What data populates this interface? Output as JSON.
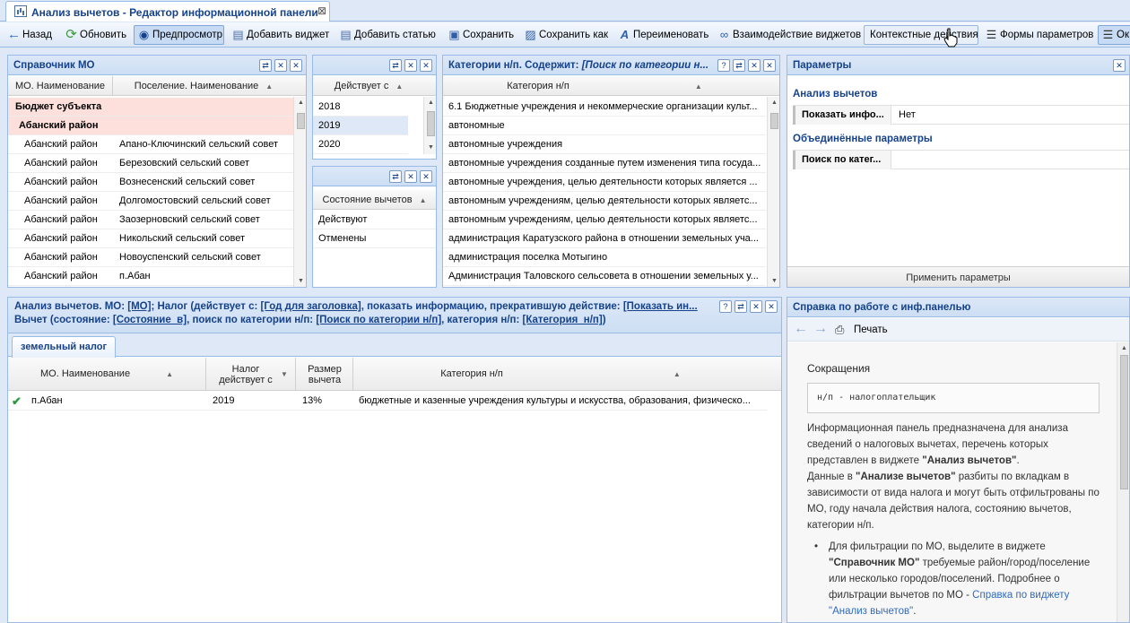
{
  "doc_tab": {
    "title": "Анализ вычетов - Редактор информационной панели",
    "close": "⊠"
  },
  "toolbar": {
    "back": "Назад",
    "refresh": "Обновить",
    "preview": "Предпросмотр",
    "add_widget": "Добавить виджет",
    "add_article": "Добавить статью",
    "save": "Сохранить",
    "save_as": "Сохранить как",
    "rename": "Переименовать",
    "widget_interaction": "Взаимодействие виджетов",
    "context_actions": "Контекстные действия",
    "param_forms": "Формы параметров",
    "ok": "Ок"
  },
  "mo_panel": {
    "title": "Справочник МО",
    "columns": [
      "МО. Наименование",
      "Поселение. Наименование"
    ],
    "rows": [
      {
        "mo": "Бюджет субъекта",
        "settlement": "",
        "style": "pink-bold"
      },
      {
        "mo": "Абанский район",
        "settlement": "",
        "style": "pink-bold-indent"
      },
      {
        "mo": "Абанский район",
        "settlement": "Апано-Ключинский сельский совет"
      },
      {
        "mo": "Абанский район",
        "settlement": "Березовский сельский совет"
      },
      {
        "mo": "Абанский район",
        "settlement": "Вознесенский сельский совет"
      },
      {
        "mo": "Абанский район",
        "settlement": "Долгомостовский сельский совет"
      },
      {
        "mo": "Абанский район",
        "settlement": "Заозерновский сельский совет"
      },
      {
        "mo": "Абанский район",
        "settlement": "Никольский сельский совет"
      },
      {
        "mo": "Абанский район",
        "settlement": "Новоуспенский сельский совет"
      },
      {
        "mo": "Абанский район",
        "settlement": "п.Абан"
      }
    ]
  },
  "year_panel": {
    "column": "Действует с",
    "rows": [
      "2018",
      "2019",
      "2020"
    ]
  },
  "state_panel": {
    "column": "Состояние вычетов",
    "rows": [
      "Действуют",
      "Отменены"
    ]
  },
  "cat_panel": {
    "title": "Категории н/п. Содержит: ",
    "title_italic": "[Поиск по категории н...",
    "column": "Категория н/п",
    "rows": [
      "6.1 Бюджетные учреждения и некоммерческие организации культ...",
      "автономные",
      "автономные учреждения",
      "автономные учреждения созданные путем изменения типа госуда...",
      "автономные учреждения, целью деятельности которых является ...",
      "автономным учреждениям, целью деятельности которых являетс...",
      "автономным учреждениям, целью деятельности которых являетс...",
      "администрация Каратузского района в отношении земельных уча...",
      "администрация поселка Мотыгино",
      "Администрация Таловского сельсовета в отношении земельных у..."
    ]
  },
  "params_panel": {
    "title": "Параметры",
    "section1": "Анализ вычетов",
    "prop1_key": "Показать инфо...",
    "prop1_val": "Нет",
    "section2": "Объединённые параметры",
    "prop2_key": "Поиск по катег...",
    "apply": "Применить параметры"
  },
  "analysis_panel": {
    "line1_a": "Анализ вычетов. МО: ",
    "link_mo": "[МО]",
    "line1_b": "; Налог (действует с: ",
    "link_year": "[Год для заголовка]",
    "line1_c": ", показать информацию, прекратившую действие: ",
    "link_show": "[Показать ин...",
    "line2_a": "Вычет (состояние: ",
    "link_state": "[Состояние_в]",
    "line2_b": ", поиск по категории н/п: ",
    "link_search": "[Поиск по категории н/п]",
    "line2_c": ", категория н/п: ",
    "link_cat": "[Категория_н/п]",
    "line2_d": ")",
    "tab": "земельный налог",
    "columns": {
      "mo": "МО. Наименование",
      "year": "Налог действует с",
      "size": "Размер вычета",
      "cat": "Категория н/п"
    },
    "rows": [
      {
        "mo": "п.Абан",
        "year": "2019",
        "size": "13%",
        "cat": "бюджетные и казенные учреждения культуры и искусства, образования, физическо..."
      }
    ]
  },
  "help_panel": {
    "title": "Справка по работе с инф.панелью",
    "print": "Печать",
    "heading": "Сокращения",
    "abbrev": "н/п -   налогоплательщик",
    "p1_a": "Информационная панель предназначена для анализа сведений о налоговых вычетах, перечень которых представлен в виджете ",
    "p1_b": "\"Анализ вычетов\"",
    "p1_c": ".",
    "p2_a": "Данные в ",
    "p2_b": "\"Анализе вычетов\"",
    "p2_c": " разбиты по вкладкам в зависимости от вида налога и могут быть отфильтрованы по МО, году начала действия налога, состоянию вычетов, категории н/п.",
    "li_a": "Для фильтрации по МО, выделите в виджете ",
    "li_b": "\"Справочник МО\"",
    "li_c": " требуемые район/город/поселение или несколько городов/поселений. Подробнее о фильтрации вычетов по МО - ",
    "li_link": "Справка по виджету \"Анализ вычетов\"",
    "li_d": "."
  }
}
